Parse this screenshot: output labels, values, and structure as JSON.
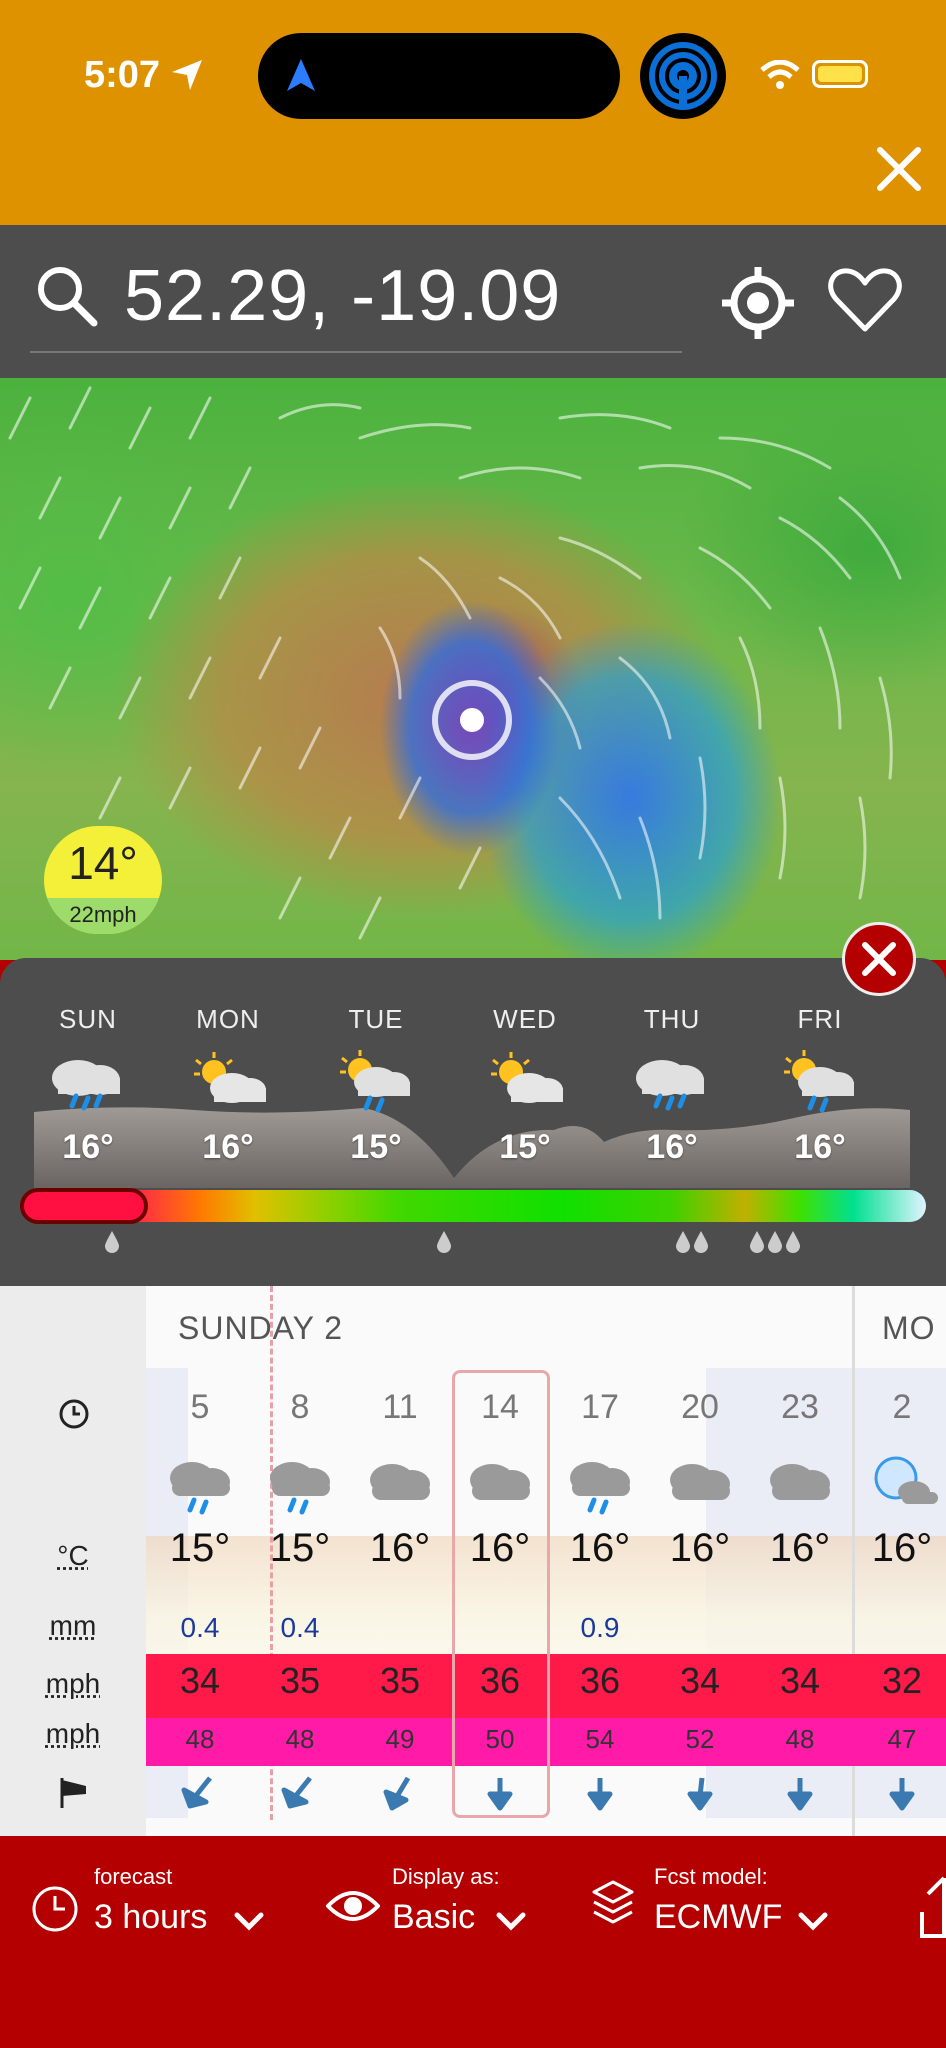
{
  "status": {
    "time": "5:07"
  },
  "search": {
    "coords": "52.29, -19.09"
  },
  "map": {
    "badge_temp": "14°",
    "badge_wind": "22mph"
  },
  "weekly": {
    "days": [
      {
        "name": "SUN",
        "temp": "16°",
        "icon": "rain-cloud-icon"
      },
      {
        "name": "MON",
        "temp": "16°",
        "icon": "sun-cloud-icon"
      },
      {
        "name": "TUE",
        "temp": "15°",
        "icon": "sun-rain-cloud-icon"
      },
      {
        "name": "WED",
        "temp": "15°",
        "icon": "sun-cloud-icon"
      },
      {
        "name": "THU",
        "temp": "16°",
        "icon": "rain-cloud-icon"
      },
      {
        "name": "FRI",
        "temp": "16°",
        "icon": "sun-rain-cloud-icon"
      }
    ]
  },
  "hourly": {
    "day_header": "SUNDAY 2",
    "next_day_header": "MO",
    "units": {
      "temp": "°C",
      "rain": "mm",
      "wind": "mph",
      "gust": "mph"
    },
    "hours": [
      "5",
      "8",
      "11",
      "14",
      "17",
      "20",
      "23",
      "2"
    ],
    "temps": [
      "15°",
      "15°",
      "16°",
      "16°",
      "16°",
      "16°",
      "16°",
      "16°"
    ],
    "rain": [
      "0.4",
      "0.4",
      "",
      "",
      "0.9",
      "",
      "",
      ""
    ],
    "wind": [
      "34",
      "35",
      "35",
      "36",
      "36",
      "34",
      "34",
      "32"
    ],
    "gust": [
      "48",
      "48",
      "49",
      "50",
      "54",
      "52",
      "48",
      "47"
    ],
    "icons": [
      "rain-cloud-icon",
      "rain-cloud-icon",
      "cloud-icon",
      "cloud-icon",
      "rain-cloud-icon",
      "cloud-icon",
      "cloud-icon",
      "moon-cloud-icon"
    ],
    "selected_hour": "14",
    "wind_direction_icon": "arrow-down-icon"
  },
  "toolbar": {
    "forecast_label": "forecast",
    "forecast_value": "3 hours",
    "display_label": "Display as:",
    "display_value": "Basic",
    "model_label": "Fcst model:",
    "model_value": "ECMWF"
  },
  "colors": {
    "status_bar": "#df9200",
    "accent_red": "#b40000",
    "panel_gray": "#4d4d4d",
    "wind_red": "#ff1a4a",
    "gust_pink": "#ff1aa8"
  }
}
